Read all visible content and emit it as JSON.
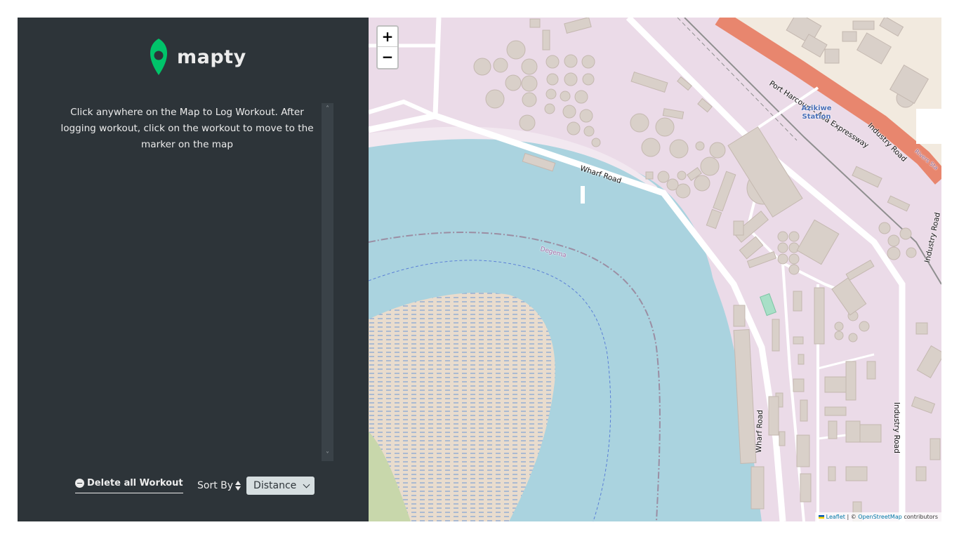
{
  "app": {
    "name": "mapty",
    "brand_color": "#00c46a"
  },
  "sidebar": {
    "instructions": "Click anywhere on the Map to Log Workout. After logging workout, click on the workout to move to the marker on the map",
    "delete_all_label": "Delete all Workout",
    "sort_label": "Sort By",
    "sort_selected": "Distance"
  },
  "map": {
    "zoom_in_label": "+",
    "zoom_out_label": "−",
    "attribution": {
      "leaflet": "Leaflet",
      "separator": " | © ",
      "osm": "OpenStreetMap",
      "suffix": " contributors"
    },
    "labels": {
      "wharf_road_top": "Wharf Road",
      "wharf_road_bottom": "Wharf Road",
      "expressway": "Port Harcourt - Aba Expressway",
      "industry_road_upper": "Industry Road",
      "industry_road_right": "Industry Road",
      "industry_road_lower": "Industry Road",
      "station": "Azikiwe Station",
      "degema": "Degema",
      "rivers": "Rivers Sta"
    }
  }
}
